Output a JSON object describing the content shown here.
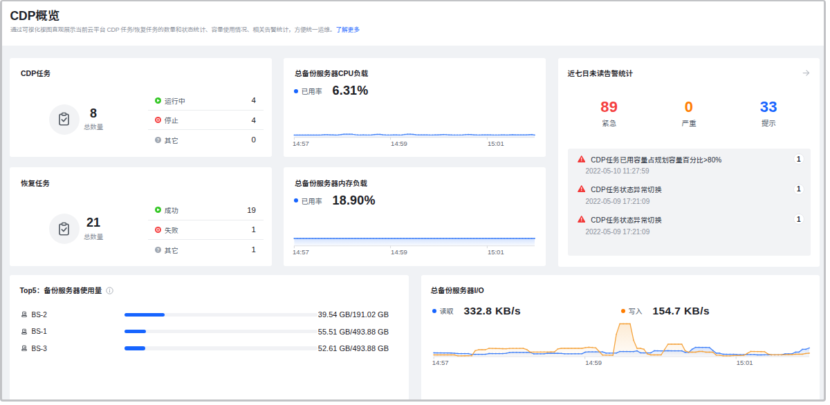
{
  "header": {
    "title": "CDP概览",
    "subtitle": "通过可视化视图直观展示当前云平台 CDP 任务/恢复任务的数量和状态统计、容量使用情况、相关告警统计，方便统一运维。",
    "learn_more": "了解更多"
  },
  "colors": {
    "accent_blue": "#1664ff",
    "alert_red": "#f53f3f",
    "alert_orange": "#ff7d00",
    "status_green": "#34c724",
    "status_red": "#f53f3f",
    "status_gray": "#9fa6b0",
    "chart_blue": "#4080f8",
    "chart_orange": "#f5a43e"
  },
  "cards": {
    "cdp_tasks": {
      "title": "CDP任务",
      "total": "8",
      "total_label": "总数量",
      "rows": [
        {
          "icon": "running-status-icon",
          "label": "运行中",
          "value": "4"
        },
        {
          "icon": "stopped-status-icon",
          "label": "停止",
          "value": "4"
        },
        {
          "icon": "other-status-icon",
          "label": "其它",
          "value": "0"
        }
      ]
    },
    "restore_tasks": {
      "title": "恢复任务",
      "total": "21",
      "total_label": "总数量",
      "rows": [
        {
          "icon": "success-status-icon",
          "label": "成功",
          "value": "19"
        },
        {
          "icon": "failed-status-icon",
          "label": "失败",
          "value": "1"
        },
        {
          "icon": "other-status-icon",
          "label": "其它",
          "value": "1"
        }
      ]
    },
    "cpu_load": {
      "title": "总备份服务器CPU负载",
      "legend": "已用率",
      "value": "6.31%"
    },
    "mem_load": {
      "title": "总备份服务器内存负载",
      "legend": "已用率",
      "value": "18.90%"
    },
    "alerts": {
      "title": "近七日未读告警统计",
      "stats": [
        {
          "value": "89",
          "label": "紧急",
          "color": "#f53f3f"
        },
        {
          "value": "0",
          "label": "严重",
          "color": "#ff7d00"
        },
        {
          "value": "33",
          "label": "提示",
          "color": "#1664ff"
        }
      ],
      "items": [
        {
          "text": "CDP任务已用容量占规划容量百分比>80%",
          "time": "2022-05-10 11:27:59",
          "count": "1"
        },
        {
          "text": "CDP任务状态异常切换",
          "time": "2022-05-09 17:21:09",
          "count": "1"
        },
        {
          "text": "CDP任务状态异常切换",
          "time": "2022-05-09 17:21:09",
          "count": "1"
        }
      ]
    },
    "top5": {
      "title": "Top5：备份服务器使用量",
      "rows": [
        {
          "name": "BS-2",
          "used_gb": 39.54,
          "total_gb": 191.02,
          "label": "39.54 GB/191.02 GB"
        },
        {
          "name": "BS-1",
          "used_gb": 55.51,
          "total_gb": 493.88,
          "label": "55.51 GB/493.88 GB"
        },
        {
          "name": "BS-3",
          "used_gb": 52.61,
          "total_gb": 493.88,
          "label": "52.61 GB/493.88 GB"
        }
      ]
    },
    "io": {
      "title": "总备份服务器I/O",
      "legends": [
        {
          "label": "读取",
          "value": "332.8 KB/s",
          "color": "#1664ff"
        },
        {
          "label": "写入",
          "value": "154.7 KB/s",
          "color": "#ff7d00"
        }
      ]
    }
  },
  "chart_data": [
    {
      "id": "cpu",
      "type": "area",
      "title": "总备份服务器CPU负载",
      "ylabel": "已用率 %",
      "ylim": [
        0,
        100
      ],
      "x_tick_labels": [
        "14:57",
        "14:59",
        "15:01"
      ],
      "series": [
        {
          "name": "已用率",
          "color": "#4080f8",
          "current": 6.31,
          "values": [
            6.1,
            6.2,
            6.3,
            6.2,
            6.3,
            6.4,
            6.3,
            6.2,
            6.3,
            6.3,
            6.5,
            6.9,
            7.1,
            6.8,
            6.5,
            6.3,
            6.5,
            7.4,
            8.3,
            8.6,
            8.5,
            8.3,
            7.3,
            6.6,
            6.4,
            6.5,
            6.4,
            6.4,
            6.7,
            7.6,
            8.1,
            7.9,
            7.0,
            6.5,
            6.4,
            6.4,
            6.6,
            6.5,
            6.4,
            6.6,
            7.8,
            8.6,
            8.4,
            8.0,
            7.1,
            6.5,
            6.7,
            6.8,
            6.6,
            6.4,
            6.4,
            6.5,
            6.7,
            7.2,
            7.6,
            7.3,
            6.8,
            6.5,
            6.4,
            6.4,
            6.4,
            6.6,
            7.3,
            7.8,
            7.5,
            6.8,
            6.5,
            6.4,
            6.5,
            6.5,
            6.6,
            6.5,
            6.4,
            6.4,
            6.4,
            6.5,
            6.5,
            6.4,
            6.7,
            7.0,
            6.8,
            6.5,
            6.5,
            6.6,
            6.6,
            7.0,
            7.5,
            6.31
          ]
        }
      ]
    },
    {
      "id": "mem",
      "type": "area",
      "title": "总备份服务器内存负载",
      "ylabel": "已用率 %",
      "ylim": [
        0,
        100
      ],
      "x_tick_labels": [
        "14:57",
        "14:59",
        "15:01"
      ],
      "series": [
        {
          "name": "已用率",
          "color": "#4080f8",
          "current": 18.9,
          "values": [
            18.9,
            18.9,
            18.9,
            18.9,
            18.9,
            18.9,
            18.9,
            18.9,
            18.9,
            18.9,
            18.9,
            18.9,
            18.9,
            18.9,
            18.9,
            18.9,
            18.9,
            18.9,
            18.9,
            18.9,
            18.9,
            18.9,
            18.9,
            18.9,
            18.9,
            18.9,
            18.9,
            18.9,
            18.9,
            18.9,
            18.9,
            18.9,
            18.9,
            18.9,
            18.9,
            18.9,
            18.9,
            18.9,
            18.9,
            18.9,
            18.9,
            18.9,
            18.9,
            18.9,
            18.9,
            18.9,
            18.9,
            18.9,
            18.9,
            18.9,
            18.9,
            18.9,
            18.9,
            18.9,
            18.9,
            18.9,
            18.9,
            18.9,
            18.9,
            18.9,
            18.9,
            18.9,
            18.9,
            18.9,
            18.9,
            18.9,
            18.9,
            18.9,
            18.9,
            18.9,
            18.9,
            18.9,
            18.9,
            18.9,
            18.9,
            18.9,
            18.9,
            18.9,
            18.9,
            18.9
          ]
        }
      ]
    },
    {
      "id": "io",
      "type": "line",
      "title": "总备份服务器I/O",
      "ylabel": "KB/s",
      "ylim": [
        0,
        2800
      ],
      "x_tick_labels": [
        "14:57",
        "14:59",
        "15:01"
      ],
      "series": [
        {
          "name": "读取",
          "color": "#4080f8",
          "current": 332.8,
          "values": [
            302,
            299,
            296,
            293,
            291,
            288,
            272,
            246,
            245,
            243,
            242,
            178,
            180,
            182,
            184,
            187,
            246,
            245,
            244,
            243,
            242,
            266,
            328,
            339,
            337,
            336,
            334,
            332,
            330,
            220,
            222,
            223,
            224,
            263,
            262,
            261,
            260,
            258,
            221,
            223,
            225,
            227,
            229,
            231,
            359,
            382,
            380,
            378,
            376,
            373,
            277,
            280,
            283,
            285,
            410,
            408,
            405,
            403,
            401,
            461,
            302,
            300,
            299,
            298,
            466,
            463,
            459,
            456,
            466,
            464,
            463,
            462,
            461,
            332,
            334,
            587,
            739,
            736,
            732,
            729,
            725,
            489,
            274,
            274,
            191,
            190,
            189,
            187,
            164,
            163,
            162,
            161,
            160,
            160,
            138,
            138,
            139,
            140,
            141,
            141,
            142,
            143,
            221,
            223,
            224,
            358,
            361,
            578,
            582,
            686
          ]
        },
        {
          "name": "写入",
          "color": "#f5a43e",
          "current": 154.7,
          "values": [
            137,
            137,
            137,
            137,
            137,
            137,
            137,
            66,
            67,
            69,
            70,
            71,
            469,
            549,
            549,
            549,
            658,
            651,
            645,
            639,
            632,
            626,
            650,
            652,
            654,
            656,
            658,
            558,
            357,
            360,
            362,
            364,
            366,
            369,
            371,
            373,
            611,
            659,
            659,
            659,
            659,
            659,
            659,
            659,
            708,
            747,
            722,
            696,
            412,
            120,
            117,
            113,
            110,
            1775,
            2608,
            2608,
            2608,
            2608,
            1308,
            659,
            659,
            584,
            212,
            137,
            137,
            137,
            137,
            563,
            988,
            988,
            988,
            988,
            988,
            462,
            357,
            357,
            357,
            412,
            412,
            357,
            357,
            357,
            121,
            121,
            66,
            66,
            66,
            86,
            90,
            94,
            99,
            255,
            412,
            408,
            404,
            399,
            395,
            211,
            139,
            141,
            144,
            146,
            149,
            151,
            154,
            192,
            192,
            192,
            253,
            274
          ]
        }
      ]
    }
  ]
}
